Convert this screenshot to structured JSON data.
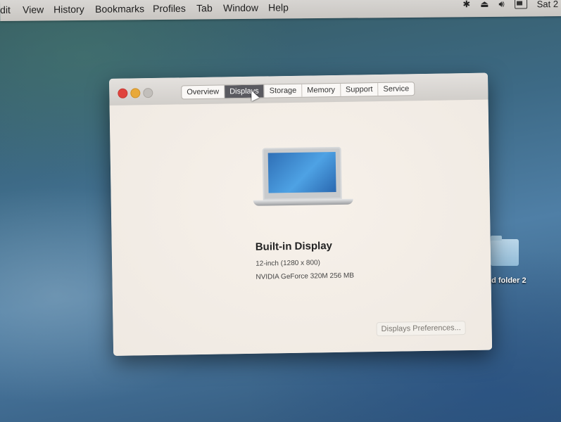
{
  "menubar": {
    "items": [
      "dit",
      "View",
      "History",
      "Bookmarks",
      "Profiles",
      "Tab",
      "Window",
      "Help"
    ],
    "clock": "Sat 2"
  },
  "desktop": {
    "folder_label": "ed folder 2"
  },
  "window": {
    "tabs": [
      "Overview",
      "Displays",
      "Storage",
      "Memory",
      "Support",
      "Service"
    ],
    "active_tab": "Displays",
    "display": {
      "title": "Built-in Display",
      "size": "12-inch (1280 x 800)",
      "graphics": "NVIDIA GeForce 320M 256 MB"
    },
    "preferences_button": "Displays Preferences..."
  }
}
